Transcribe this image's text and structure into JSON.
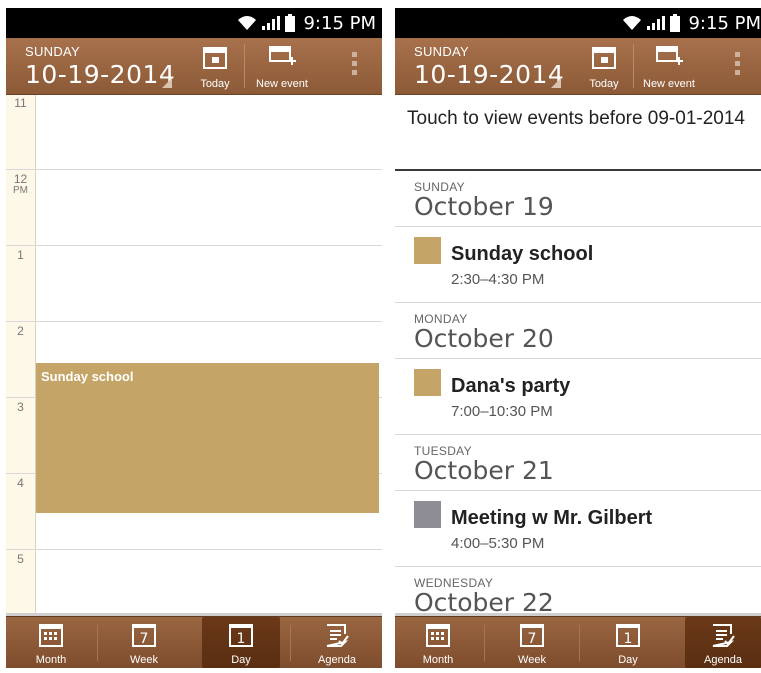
{
  "status": {
    "time": "9:15 PM"
  },
  "header": {
    "day_name": "SUNDAY",
    "date": "10-19-2014",
    "today_label": "Today",
    "new_event_label": "New event"
  },
  "tabs": {
    "month": "Month",
    "week": "Week",
    "day": "Day",
    "agenda": "Agenda",
    "month_num": "",
    "week_num": "7",
    "day_num": "1"
  },
  "day_view": {
    "hours": [
      {
        "label": "11",
        "suffix": ""
      },
      {
        "label": "12",
        "suffix": "PM"
      },
      {
        "label": "1",
        "suffix": ""
      },
      {
        "label": "2",
        "suffix": ""
      },
      {
        "label": "3",
        "suffix": ""
      },
      {
        "label": "4",
        "suffix": ""
      },
      {
        "label": "5",
        "suffix": ""
      }
    ],
    "event_title": "Sunday school"
  },
  "agenda": {
    "before_text": "Touch to view events before 09-01-2014",
    "days": [
      {
        "day": "SUNDAY",
        "date": "October 19",
        "event": {
          "title": "Sunday school",
          "time": "2:30–4:30 PM",
          "color": "#c4a467"
        }
      },
      {
        "day": "MONDAY",
        "date": "October 20",
        "event": {
          "title": "Dana's party",
          "time": "7:00–10:30 PM",
          "color": "#c4a467"
        }
      },
      {
        "day": "TUESDAY",
        "date": "October 21",
        "event": {
          "title": "Meeting w Mr. Gilbert",
          "time": "4:00–5:30 PM",
          "color": "#8e8c95"
        }
      },
      {
        "day": "WEDNESDAY",
        "date": "October 22"
      }
    ]
  },
  "colors": {
    "header_brown": "#9a6642",
    "event_tan": "#c4a467",
    "event_gray": "#8e8c95",
    "gutter_cream": "#fdf8e7"
  }
}
